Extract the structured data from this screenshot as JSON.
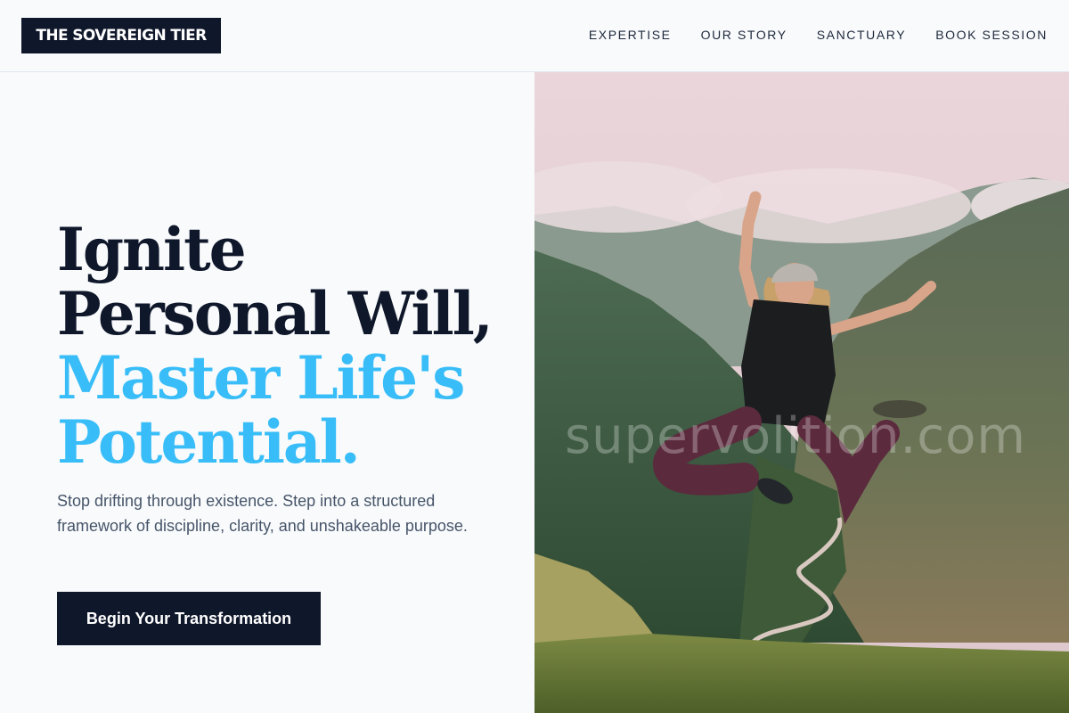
{
  "header": {
    "logo": "THE SOVEREIGN TIER",
    "nav": [
      {
        "label": "EXPERTISE"
      },
      {
        "label": "OUR STORY"
      },
      {
        "label": "SANCTUARY"
      },
      {
        "label": "BOOK SESSION"
      }
    ]
  },
  "hero": {
    "headline_line1": "Ignite",
    "headline_line2": "Personal Will,",
    "headline_accent_line1": "Master Life's",
    "headline_accent_line2": "Potential.",
    "subtext": "Stop drifting through existence. Step into a structured framework of discipline, clarity, and unshakeable purpose.",
    "cta_label": "Begin Your Transformation",
    "image_watermark": "supervolition.com",
    "image_alt": "Person jumping with arms raised in front of misty green mountains"
  },
  "colors": {
    "navy": "#0f172a",
    "accent": "#38bdf8",
    "background": "#f8fafc",
    "body_text": "#475569"
  }
}
